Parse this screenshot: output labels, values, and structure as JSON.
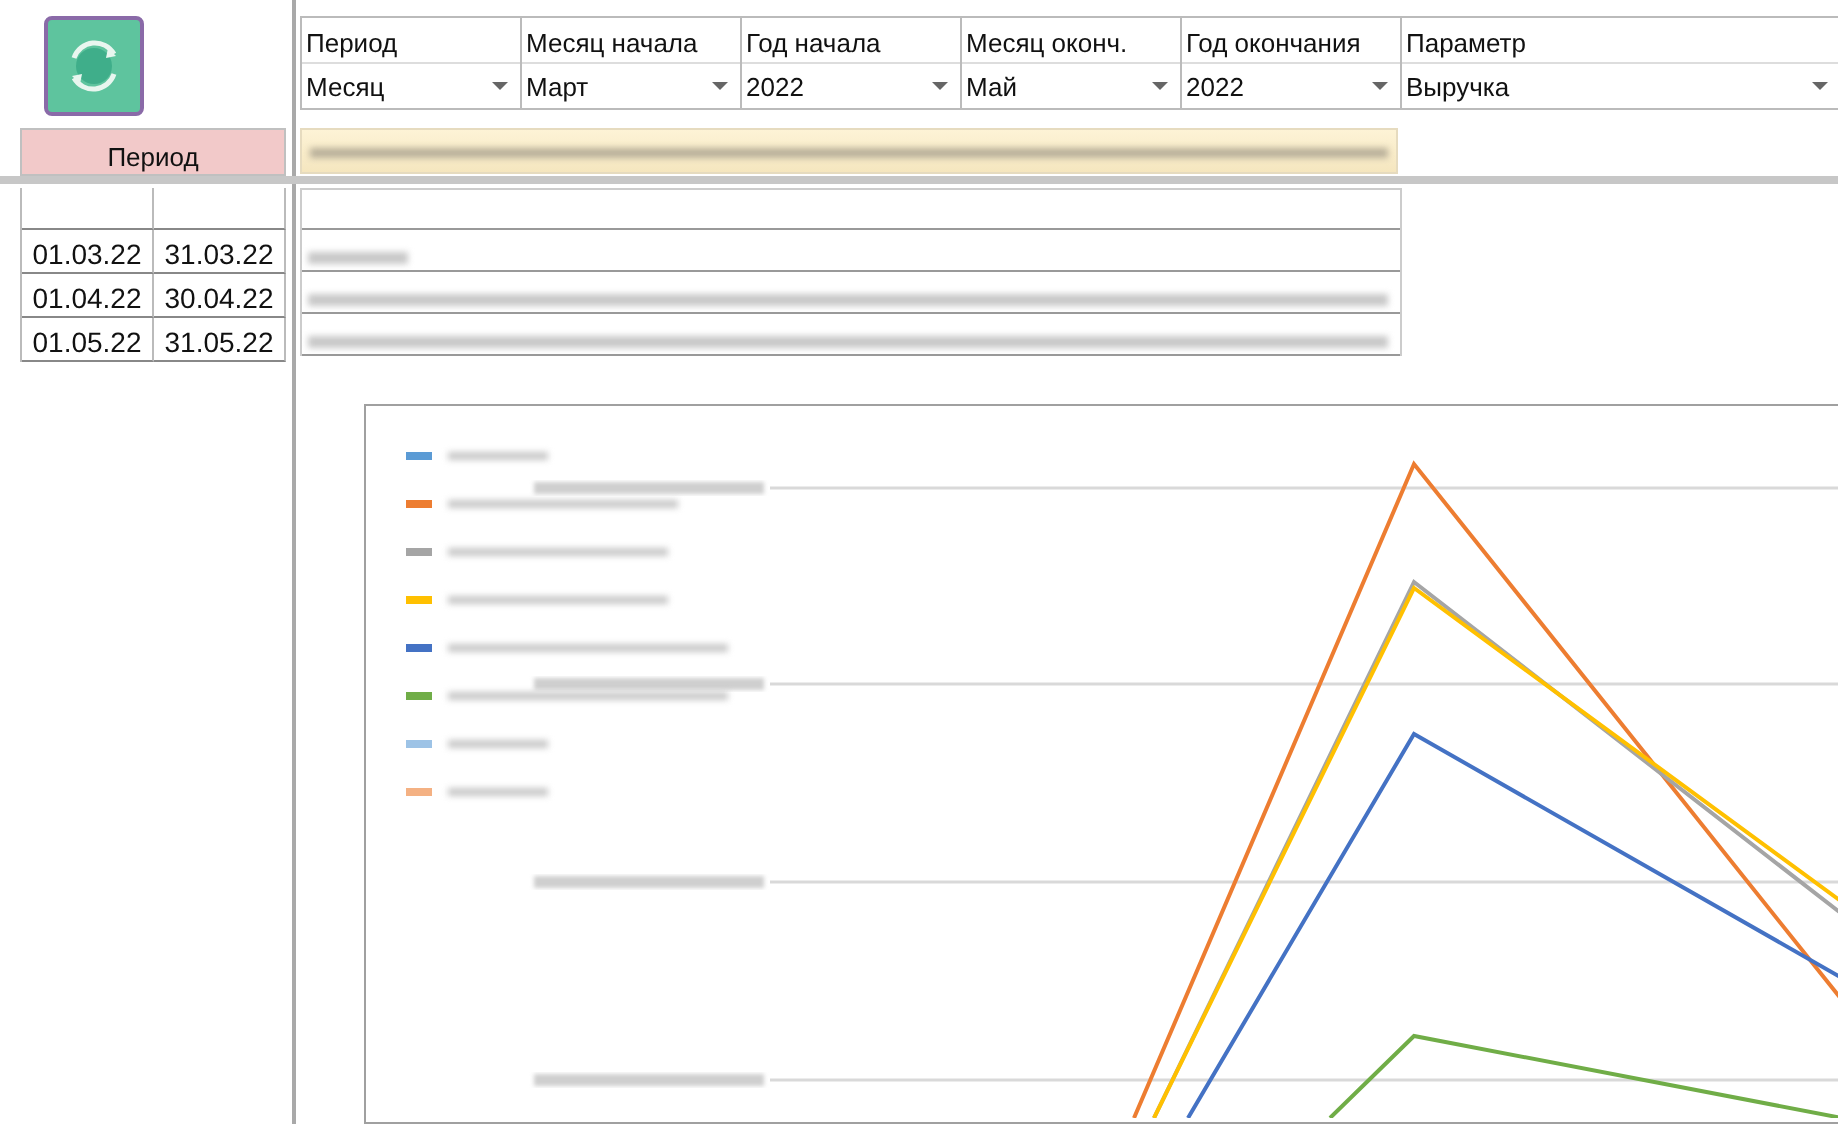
{
  "period_header": "Период",
  "period_rows": [
    {
      "start": "01.03.22",
      "end": "31.03.22"
    },
    {
      "start": "01.04.22",
      "end": "30.04.22"
    },
    {
      "start": "01.05.22",
      "end": "31.05.22"
    }
  ],
  "filters": [
    {
      "label": "Период",
      "value": "Месяц"
    },
    {
      "label": "Месяц начала",
      "value": "Март"
    },
    {
      "label": "Год начала",
      "value": "2022"
    },
    {
      "label": "Месяц оконч.",
      "value": "Май"
    },
    {
      "label": "Год окончания",
      "value": "2022"
    },
    {
      "label": "Параметр",
      "value": "Выручка"
    }
  ],
  "chart": {
    "legend": [
      {
        "color": "#5b9bd5"
      },
      {
        "color": "#ed7d31"
      },
      {
        "color": "#a5a5a5"
      },
      {
        "color": "#ffc000"
      },
      {
        "color": "#4472c4"
      },
      {
        "color": "#70ad47"
      },
      {
        "color": "#9dc3e6"
      },
      {
        "color": "#f4b183"
      }
    ]
  }
}
